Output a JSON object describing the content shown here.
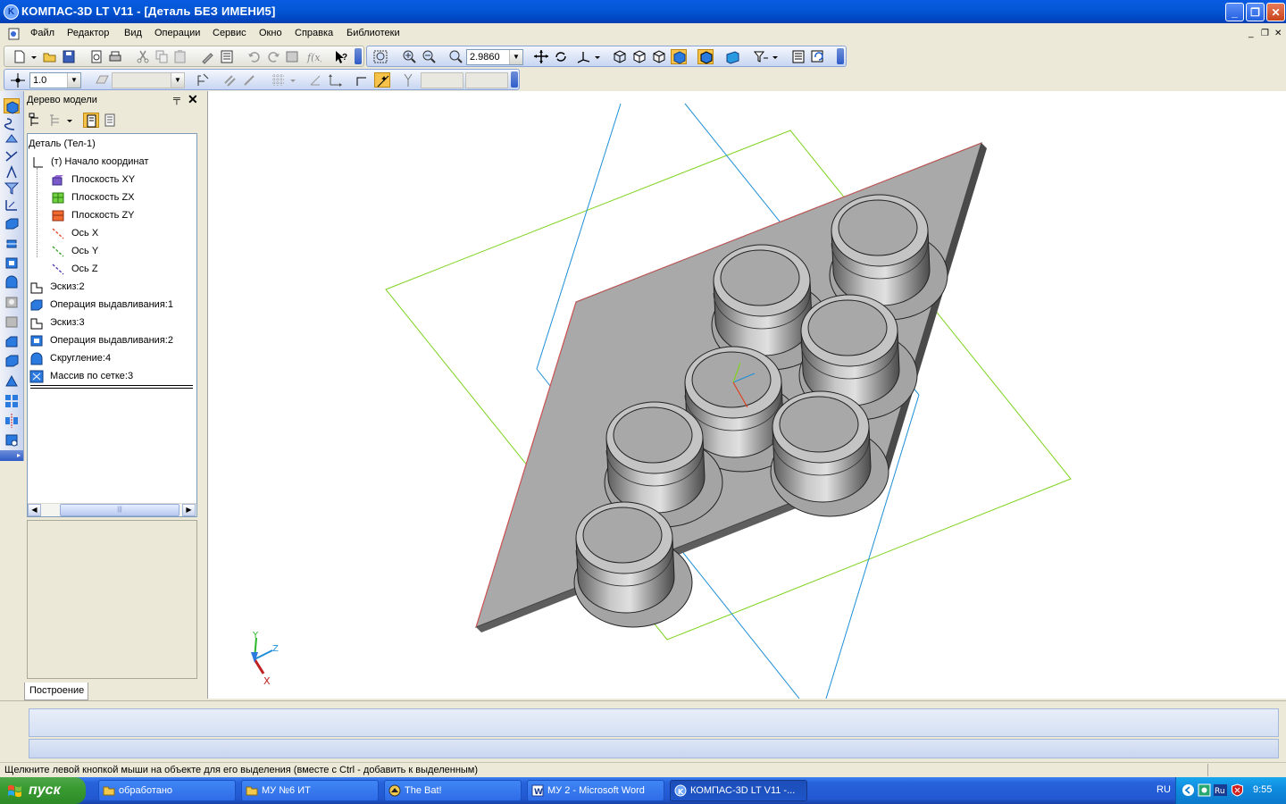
{
  "window": {
    "title": "КОМПАС-3D LT V11 - [Деталь БЕЗ ИМЕНИ5]",
    "minimize": "_",
    "restore": "❐",
    "close": "✕"
  },
  "menu": {
    "items": [
      "Файл",
      "Редактор",
      "Вид",
      "Операции",
      "Сервис",
      "Окно",
      "Справка",
      "Библиотеки"
    ],
    "doc_min": "_",
    "doc_restore": "❐",
    "doc_close": "✕"
  },
  "toolbar": {
    "zoom_value": "2.9860",
    "step_value": "1.0"
  },
  "tree_panel": {
    "title": "Дерево модели",
    "pin": "╤",
    "close": "✕",
    "tab": "Построение",
    "items": [
      {
        "label": "Деталь (Тел-1)",
        "icon": "part-icon"
      },
      {
        "label": "(т) Начало координат",
        "icon": "origin-icon"
      },
      {
        "label": "Плоскость XY",
        "icon": "plane-xy-icon"
      },
      {
        "label": "Плоскость ZX",
        "icon": "plane-zx-icon"
      },
      {
        "label": "Плоскость ZY",
        "icon": "plane-zy-icon"
      },
      {
        "label": "Ось X",
        "icon": "axis-x-icon"
      },
      {
        "label": "Ось Y",
        "icon": "axis-y-icon"
      },
      {
        "label": "Ось Z",
        "icon": "axis-z-icon"
      },
      {
        "label": "Эскиз:2",
        "icon": "sketch-icon"
      },
      {
        "label": "Операция выдавливания:1",
        "icon": "extrude-icon"
      },
      {
        "label": "Эскиз:3",
        "icon": "sketch-icon"
      },
      {
        "label": "Операция выдавливания:2",
        "icon": "extrude-icon"
      },
      {
        "label": "Скругление:4",
        "icon": "fillet-icon"
      },
      {
        "label": "Массив по сетке:3",
        "icon": "grid-array-icon"
      }
    ]
  },
  "viewport": {
    "axis_labels": {
      "x": "X",
      "y": "Y",
      "z": "Z"
    }
  },
  "status": {
    "text": "Щелкните левой кнопкой мыши на объекте для его выделения (вместе с Ctrl - добавить к выделенным)"
  },
  "taskbar": {
    "start": "пуск",
    "tasks": [
      {
        "label": "обработано",
        "icon": "folder-icon"
      },
      {
        "label": "МУ №6 ИТ",
        "icon": "folder-icon"
      },
      {
        "label": "The Bat!",
        "icon": "thebat-icon"
      },
      {
        "label": "МУ 2 - Microsoft Word",
        "icon": "word-icon"
      },
      {
        "label": "КОМПАС-3D LT V11 -...",
        "icon": "kompas-icon"
      }
    ],
    "language": "RU",
    "clock": "9:55"
  },
  "colors": {
    "title_bar": "#0458d6",
    "viewport_bg": "#ffffff",
    "plane_zx": "#7fd320",
    "plane_zy": "#1e8fd6",
    "part_face": "#a8a8a8",
    "taskbar": "#2258d2"
  }
}
